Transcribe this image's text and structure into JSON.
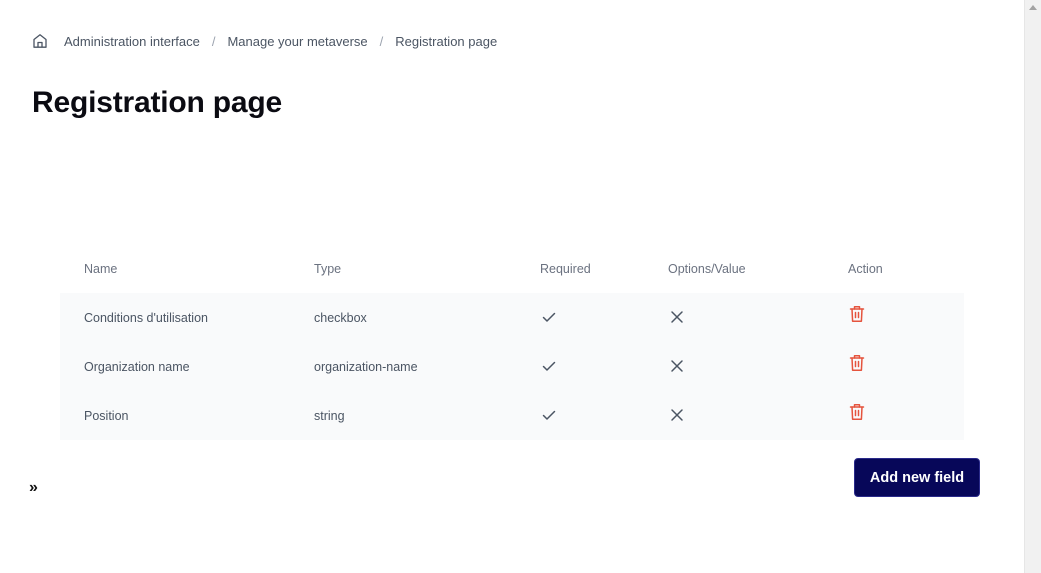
{
  "breadcrumb": {
    "home_icon": "home-icon",
    "items": [
      "Administration interface",
      "Manage your metaverse",
      "Registration page"
    ],
    "separator": "/"
  },
  "page": {
    "title": "Registration page"
  },
  "table": {
    "columns": [
      "Name",
      "Type",
      "Required",
      "Options/Value",
      "Action"
    ],
    "rows": [
      {
        "name": "Conditions d'utilisation",
        "type": "checkbox",
        "required": true,
        "options": false,
        "action_icon": "trash-icon"
      },
      {
        "name": "Organization name",
        "type": "organization-name",
        "required": true,
        "options": false,
        "action_icon": "trash-icon"
      },
      {
        "name": "Position",
        "type": "string",
        "required": true,
        "options": false,
        "action_icon": "trash-icon"
      }
    ]
  },
  "actions": {
    "add_field_label": "Add new field"
  },
  "sidebar_toggle": {
    "label": "»",
    "icon": "double-chevron-right-icon"
  },
  "colors": {
    "primary": "#070759",
    "danger": "#e5533d",
    "row_bg": "#f9fafb",
    "muted_text": "#4b5563"
  }
}
